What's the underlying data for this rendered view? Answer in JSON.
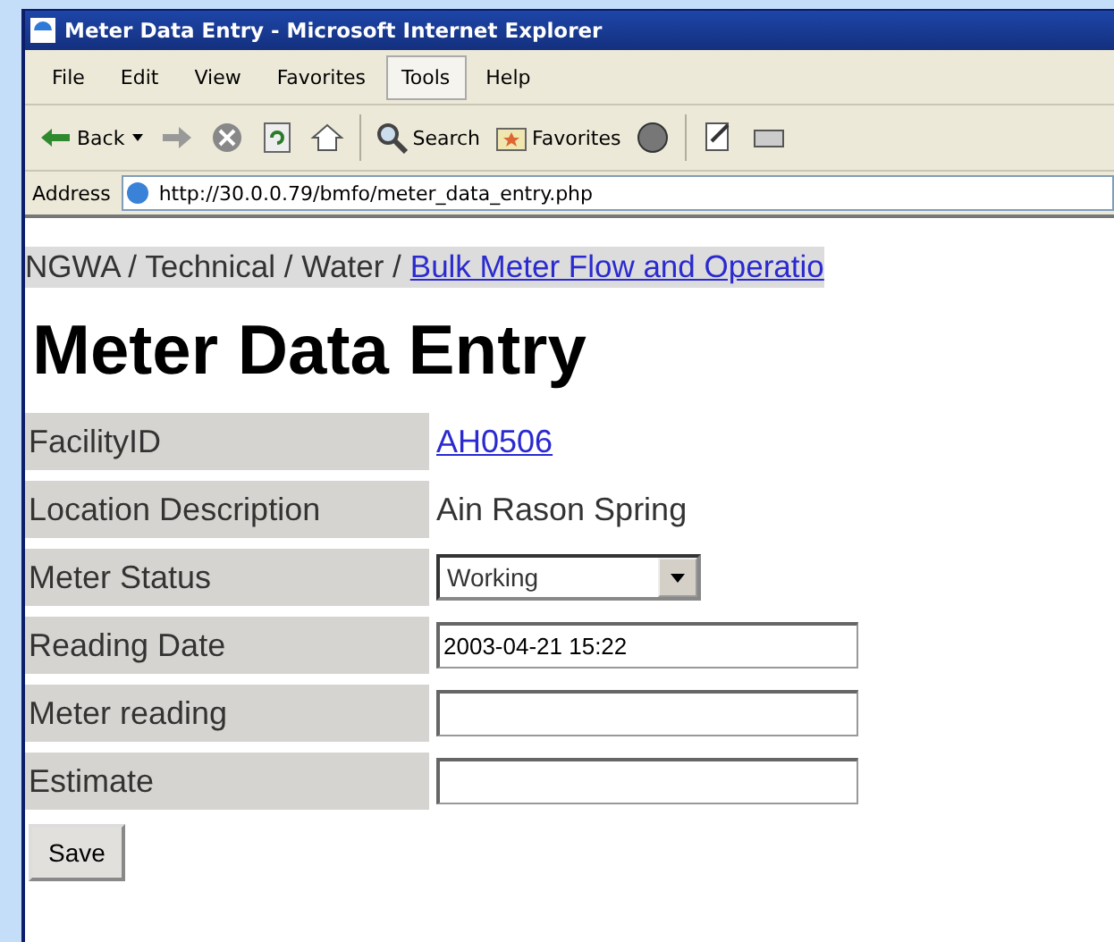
{
  "window": {
    "title": "Meter Data Entry - Microsoft Internet Explorer"
  },
  "menu": [
    {
      "label": "File",
      "selected": false
    },
    {
      "label": "Edit",
      "selected": false
    },
    {
      "label": "View",
      "selected": false
    },
    {
      "label": "Favorites",
      "selected": false
    },
    {
      "label": "Tools",
      "selected": true
    },
    {
      "label": "Help",
      "selected": false
    }
  ],
  "toolbar": {
    "back": "Back",
    "search": "Search",
    "favorites": "Favorites"
  },
  "address": {
    "label": "Address",
    "value": "http://30.0.0.79/bmfo/meter_data_entry.php"
  },
  "breadcrumb": {
    "path": "NGWA / Technical / Water /",
    "link": "Bulk Meter Flow and Operatio"
  },
  "heading": "Meter Data Entry",
  "form": [
    {
      "kind": "link",
      "label": "FacilityID",
      "value": "AH0506"
    },
    {
      "kind": "text",
      "label": "Location Description",
      "value": "Ain Rason Spring"
    },
    {
      "kind": "select",
      "label": "Meter Status",
      "value": "Working"
    },
    {
      "kind": "input",
      "label": "Reading Date",
      "value": "2003-04-21 15:22"
    },
    {
      "kind": "input",
      "label": "Meter reading"
    },
    {
      "kind": "input",
      "label": "Estimate"
    }
  ],
  "save_button": "Save"
}
